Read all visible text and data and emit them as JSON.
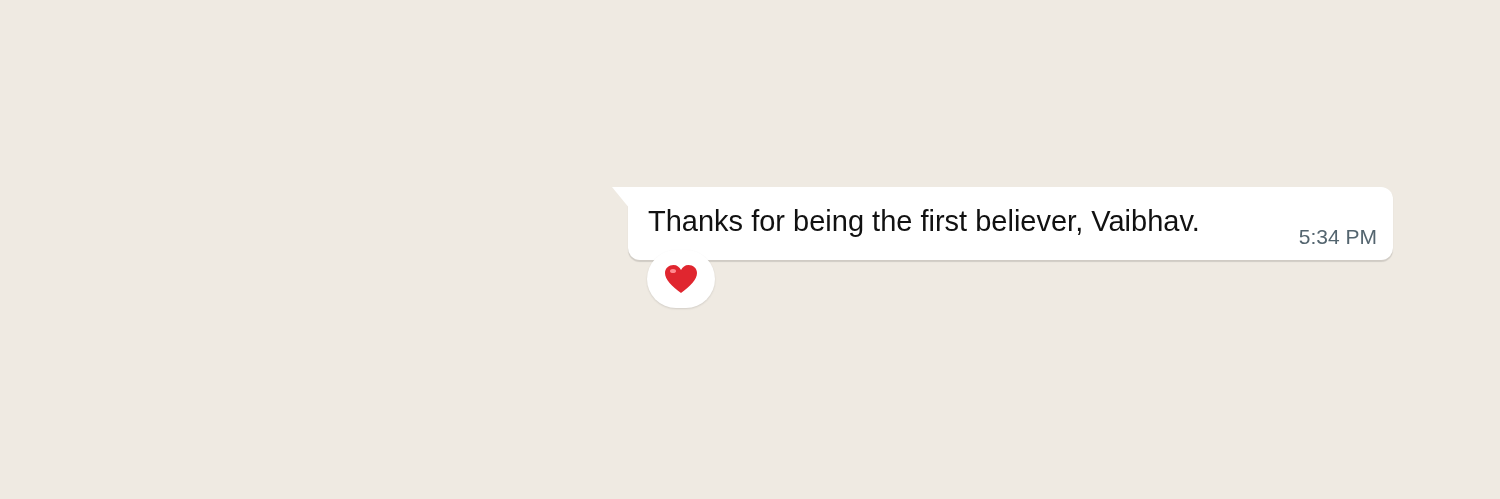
{
  "message": {
    "text": "Thanks for being the first believer, Vaibhav.",
    "time": "5:34 PM",
    "reaction": {
      "kind": "heart"
    }
  }
}
